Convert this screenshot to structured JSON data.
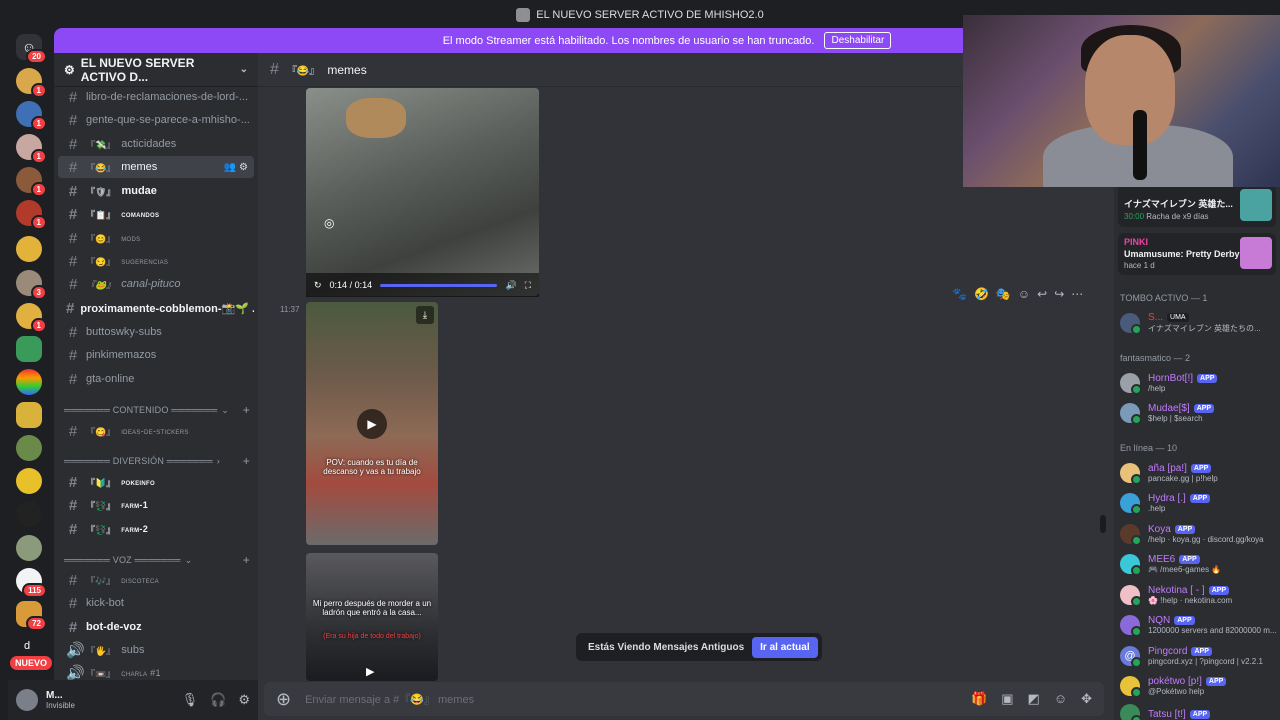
{
  "window": {
    "title": "EL NUEVO SERVER ACTIVO DE MHISHO2.0"
  },
  "banner": {
    "text": "El modo Streamer está habilitado. Los nombres de usuario se han truncado.",
    "button": "Deshabilitar"
  },
  "servers": {
    "home_badge": "20",
    "badges": [
      "1",
      "1",
      "1",
      "1",
      "1",
      "3",
      "1",
      "115",
      "72"
    ],
    "new_label": "NUEVO",
    "d_label": "d"
  },
  "guild": {
    "name": "EL NUEVO SERVER ACTIVO D..."
  },
  "channels": [
    {
      "name": "libro-de-reclamaciones-de-lord-..."
    },
    {
      "name": "gente-que-se-parece-a-mhisho-..."
    },
    {
      "prefix": "『💸』",
      "name": "acticidades"
    },
    {
      "prefix": "『😂』",
      "name": "memes"
    },
    {
      "prefix": "『🛡』",
      "name": "mudae"
    },
    {
      "prefix": "『📋』",
      "name": "comandos"
    },
    {
      "prefix": "『😊』",
      "name": "mods"
    },
    {
      "prefix": "『😏』",
      "name": "sugerencias"
    },
    {
      "prefix": "『🐸』",
      "name": "canal-pituco"
    },
    {
      "name": "proximamente-cobblemon-📸🌱 ..."
    },
    {
      "name": "buttoswky-subs"
    },
    {
      "name": "pinkimemazos"
    },
    {
      "name": "gta-online"
    }
  ],
  "categories": {
    "contenido": "═══════ CONTENIDO ═══════",
    "diversion": "═══════ DIVERSIÓN ═══════",
    "voz": "═══════ VOZ ═══════"
  },
  "channels2": [
    {
      "prefix": "『😋』",
      "name": "ideas-de-stickers"
    },
    {
      "prefix": "『🔰』",
      "name": "pokeinfo"
    },
    {
      "prefix": "『💱』",
      "name": "farm-1"
    },
    {
      "prefix": "『💱』",
      "name": "farm-2"
    },
    {
      "prefix": "『🎶』",
      "name": "discoteca"
    },
    {
      "name": "kick-bot"
    },
    {
      "name": "bot-de-voz"
    },
    {
      "prefix": "『🖐』",
      "name": "subs"
    },
    {
      "prefix": "『📼』",
      "name": "charla #1"
    }
  ],
  "user": {
    "name": "M...",
    "status": "Invisible"
  },
  "channel_header": {
    "prefix": "『😂』",
    "name": "memes"
  },
  "messages": {
    "video1": {
      "time": "0:14 / 0:14",
      "progress": 1.0
    },
    "timestamp": "11:37",
    "video2_caption": "POV: cuando es tu día de descanso y vas a tu trabajo",
    "video3_caption": "Mi perro después de morder a un ladrón que entró a la casa...",
    "video3_sub": "(Era su hija de todo del trabajo)"
  },
  "old_messages": {
    "text": "Estás Viendo Mensajes Antiguos",
    "button": "Ir al actual"
  },
  "composer": {
    "placeholder": "Enviar mensaje a #『😂』 memes"
  },
  "members": {
    "activity1": {
      "title": "イナズマイレブン 英雄た...",
      "sub": "30:00",
      "streak": "Racha de x9 días"
    },
    "activity2": {
      "name": "PINKI",
      "title": "Umamusume: Pretty Derby",
      "sub": "hace 1 d"
    },
    "group_tombo": "TOMBO ACTIVO — 1",
    "tombo_member": {
      "name": "S...",
      "tag": "UMA",
      "sub": "イナズマイレブン 英雄たちの..."
    },
    "group_fantasmatico": "fantasmatico — 2",
    "fantasmatico": [
      {
        "name": "HornBot[!]",
        "tag": "APP",
        "sub": "/help",
        "color": "#c27cff"
      },
      {
        "name": "Mudae[$]",
        "tag": "APP",
        "sub": "$help | $search",
        "color": "#c27cff"
      }
    ],
    "group_online": "En línea — 10",
    "online": [
      {
        "name": "aña [pa!]",
        "tag": "APP",
        "sub": "pancake.gg | p!help",
        "color": "#c27cff"
      },
      {
        "name": "Hydra [.]",
        "tag": "APP",
        "sub": ".help",
        "color": "#c27cff"
      },
      {
        "name": "Koya",
        "tag": "APP",
        "sub": "/help · koya.gg · discord.gg/koya",
        "color": "#c27cff"
      },
      {
        "name": "MEE6",
        "tag": "APP",
        "sub": "🎮 /mee6-games 🔥",
        "color": "#c27cff"
      },
      {
        "name": "Nekotina [ - ]",
        "tag": "APP",
        "sub": "🌸 !help · nekotina.com",
        "color": "#c27cff"
      },
      {
        "name": "NQN",
        "tag": "APP",
        "sub": "1200000 servers and 82000000 m...",
        "color": "#c27cff"
      },
      {
        "name": "Pingcord",
        "tag": "APP",
        "sub": "pingcord.xyz | ?pingcord | v2.2.1",
        "color": "#c27cff"
      },
      {
        "name": "pokétwo [p!]",
        "tag": "APP",
        "sub": "@Pokétwo help",
        "color": "#c27cff"
      },
      {
        "name": "Tatsu [t!]",
        "tag": "APP",
        "sub": "",
        "color": "#c27cff"
      }
    ]
  },
  "colors": {
    "accent": "#5865f2",
    "banner": "#8c49f5",
    "danger": "#f23f43",
    "online": "#23a55a"
  }
}
